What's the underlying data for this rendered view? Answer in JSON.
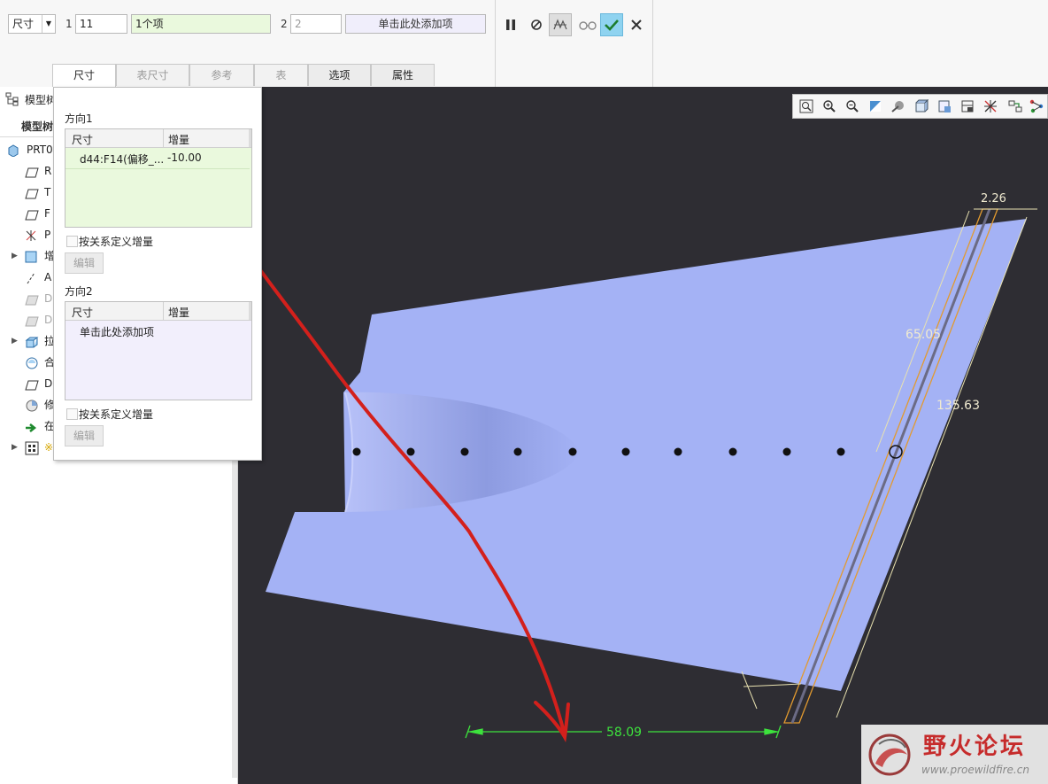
{
  "ribbon": {
    "dim_dropdown": "尺寸",
    "dir1_label": "1",
    "dir1_count": "11",
    "dir1_items": "1个项",
    "dir2_label": "2",
    "dir2_count": "2",
    "dir2_items": "单击此处添加项",
    "tabs": [
      {
        "label": "尺寸",
        "state": "active"
      },
      {
        "label": "表尺寸",
        "state": "disabled"
      },
      {
        "label": "参考",
        "state": "disabled"
      },
      {
        "label": "表",
        "state": "disabled"
      },
      {
        "label": "选项",
        "state": "normal"
      },
      {
        "label": "属性",
        "state": "normal"
      }
    ],
    "icons": [
      "pause-icon",
      "stop-icon",
      "preview-icon",
      "glasses-icon",
      "confirm-check-icon",
      "cancel-x-icon"
    ]
  },
  "tree": {
    "title": "模型树",
    "subtitle": "模型树",
    "items": [
      {
        "label": "PRT0",
        "icon": "part-icon",
        "expand": false
      },
      {
        "label": "R",
        "icon": "datum-plane-icon",
        "expand": false
      },
      {
        "label": "T",
        "icon": "datum-plane-icon",
        "expand": false
      },
      {
        "label": "F",
        "icon": "datum-plane-icon",
        "expand": false
      },
      {
        "label": "P",
        "icon": "coordinate-system-icon",
        "expand": false
      },
      {
        "label": "增",
        "icon": "feature-icon",
        "expand": true
      },
      {
        "label": "A",
        "icon": "axis-icon",
        "expand": false
      },
      {
        "label": "D",
        "icon": "datum-plane-gray-icon",
        "expand": false
      },
      {
        "label": "D",
        "icon": "datum-plane-gray-icon",
        "expand": false
      },
      {
        "label": "拉",
        "icon": "extrude-icon",
        "expand": true
      },
      {
        "label": "合",
        "icon": "merge-icon",
        "expand": false
      },
      {
        "label": "D",
        "icon": "datum-plane-icon",
        "expand": false
      },
      {
        "label": "修",
        "icon": "modify-icon",
        "expand": false
      },
      {
        "label": "在",
        "icon": "insert-arrow-icon",
        "expand": false
      },
      {
        "label": "※",
        "icon": "pattern-icon",
        "expand": true
      }
    ]
  },
  "panel": {
    "dir1_title": "方向1",
    "dir2_title": "方向2",
    "col_dim": "尺寸",
    "col_inc": "增量",
    "dir1_row_dim": "d44:F14(偏移_...",
    "dir1_row_inc": "-10.00",
    "dir2_placeholder": "单击此处添加项",
    "relation_checkbox": "按关系定义增量",
    "edit_button": "编辑"
  },
  "graphics": {
    "dims": {
      "d_top": "2.26",
      "d_upper": "65.05",
      "d_long": "135.63",
      "d_bottom": "58.09"
    },
    "watermark_title": "野火论坛",
    "watermark_url": "www.proewildfire.cn",
    "colors": {
      "background": "#2e2d33",
      "surface": "#a4b2f5",
      "dimension_green": "#3de23d",
      "annotation_red": "#d3201c",
      "orange_outline": "#e29a2f"
    }
  }
}
